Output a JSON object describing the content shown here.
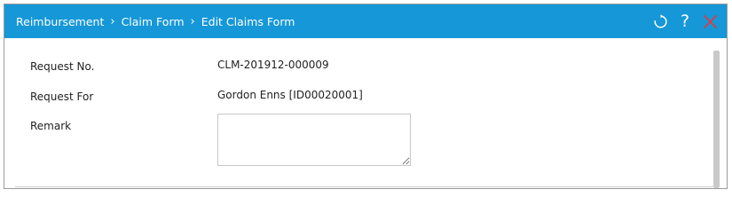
{
  "breadcrumb": {
    "items": [
      "Reimbursement",
      "Claim Form",
      "Edit Claims Form"
    ],
    "separator": "›"
  },
  "actions": {
    "refresh_icon": "refresh-icon",
    "help_label": "?",
    "close_icon": "close-icon",
    "close_color": "#e23b3b"
  },
  "form": {
    "request_no_label": "Request No.",
    "request_no_value": "CLM-201912-000009",
    "request_for_label": "Request For",
    "request_for_value": "Gordon Enns [ID00020001]",
    "remark_label": "Remark",
    "remark_value": ""
  },
  "theme": {
    "header_color": "#1597d8"
  }
}
